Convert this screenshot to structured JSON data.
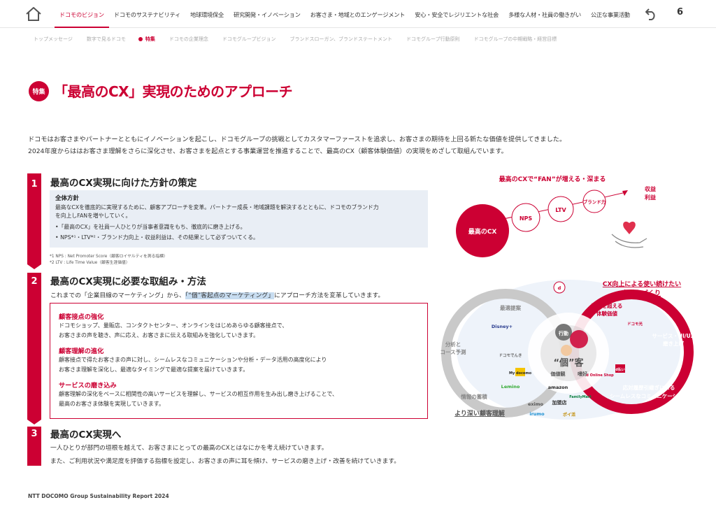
{
  "nav": {
    "items": [
      {
        "label": "ドコモのビジョン",
        "active": true
      },
      {
        "label": "ドコモのサステナビリティ"
      },
      {
        "label": "地球環境保全"
      },
      {
        "label": "研究開発・イノベーション"
      },
      {
        "label": "お客さま・地域とのエンゲージメント"
      },
      {
        "label": "安心・安全でレジリエントな社会"
      },
      {
        "label": "多様な人材・社員の働きがい"
      },
      {
        "label": "公正な事業活動"
      }
    ],
    "page_number": "6"
  },
  "subnav": {
    "items": [
      "トップメッセージ",
      "数字で見るドコモ",
      "特集",
      "ドコモの企業理念",
      "ドコモグループビジョン",
      "ブランドスローガン、ブランドステートメント",
      "ドコモグループ行動原則",
      "ドコモグループの中期戦略・経営目標"
    ],
    "active_index": 2
  },
  "title": {
    "badge": "特集",
    "text": "「最高のCX」実現のためのアプローチ"
  },
  "intro": [
    "ドコモはお客さまやパートナーとともにイノベーションを起こし、ドコモグループの挑戦としてカスタマーファーストを追求し、お客さまの期待を上回る新たな価値を提供してきました。",
    "2024年度からははお客さま理解をさらに深化させ、お客さまを起点とする事業運営を推進することで、最高のCX（顧客体験価値）の実現をめざして取組んでいます。"
  ],
  "step1": {
    "num": "1",
    "heading": "最高のCX実現に向けた方針の策定",
    "box_title": "全体方針",
    "box_text_1": "最高なCXを徹底的に実現するために、顧客アプローチを変革。パートナー成長・地域課題を解決するとともに、ドコモのブランド力",
    "box_text_2": "を向上しFANを増やしていく。",
    "bullet_1": "•「最高のCX」を社員一人ひとりが当事者意識をもち、徹底的に磨き上げる。",
    "bullet_2": "• NPS*¹・LTV*²・ブランド力向上・収益利益は、その結果として必ずついてくる。",
    "foot_1": "*1 NPS : Net Promoter Score（顧客ロイヤルティを測る指標）",
    "foot_2": "*2 LTV : Life Time Value（顧客生涯価値）"
  },
  "step2": {
    "num": "2",
    "heading": "最高のCX実現に必要な取組み・方法",
    "lead_a": "これまでの「企業目線のマーケティング」から、",
    "lead_hl": "「“個”客起点のマーケティング」",
    "lead_b": "にアプローチ方法を変革していきます。",
    "sections": [
      {
        "title": "顧客接点の強化",
        "lines": [
          "ドコモショップ、量販店、コンタクトセンター、オンラインをはじめあらゆる顧客接点で、",
          "お客さまの声を聴き、声に応え、お客さまに伝える取組みを強化していきます。"
        ]
      },
      {
        "title": "顧客理解の進化",
        "lines": [
          "顧客接点で得たお客さまの声に対し、シームレスなコミュニケーションや分析・データ活用の高度化により",
          "お客さま理解を深化し、最適なタイミングで最適な提案を届けていきます。"
        ]
      },
      {
        "title": "サービスの磨き込み",
        "lines": [
          "顧客理解の深化をベースに相関性の高いサービスを理解し、サービスの相互作用を生み出し磨き上げることで、",
          "最高のお客さま体験を実現していきます。"
        ]
      }
    ]
  },
  "step3": {
    "num": "3",
    "heading": "最高のCX実現へ",
    "line_1": "一人ひとりが部門の垣根を越えて、お客さまにとっての最高のCXとはなにかを考え続けていきます。",
    "line_2": "また、ご利用状況や満足度を評価する指標を設定し、お客さまの声に耳を傾け、サービスの磨き上げ・改善を続けていきます。"
  },
  "diagram1": {
    "title": "最高のCXで“FAN”が増える・深まる",
    "main": "最高のCX",
    "nodes": [
      "NPS",
      "LTV",
      "ブランド力"
    ],
    "result_1": "収益",
    "result_2": "利益"
  },
  "diagram2": {
    "right_title_1": "CX向上による使い続けたい",
    "right_title_2": "気持ちづくり",
    "left_bottom": "より深い顧客理解",
    "center_1": "“個”客",
    "center_action": "行動",
    "center_values": "価値観",
    "center_pref": "嗜好",
    "labels": [
      "最適提案",
      "分析と",
      "コース予測",
      "情報の蓄積",
      "期待を超える",
      "体験価値",
      "サービス・UI/UX",
      "磨き上げ",
      "応対履歴引継ぎによる",
      "シームレスなコミュニケーション"
    ],
    "logos": [
      "d",
      "Disney+",
      "ドコモでんき",
      "My docomo",
      "Lemino",
      "amazon",
      "eximo",
      "irumo",
      "FamilyMart",
      "加盟店",
      "d Online Shop",
      "ドコモ光",
      "d払い",
      "ポイ活"
    ]
  },
  "footer": "NTT DOCOMO Group Sustainability Report 2024",
  "colors": {
    "accent": "#cc0033",
    "box_bg": "#e9eef5",
    "highlight": "#c7dcf0"
  }
}
